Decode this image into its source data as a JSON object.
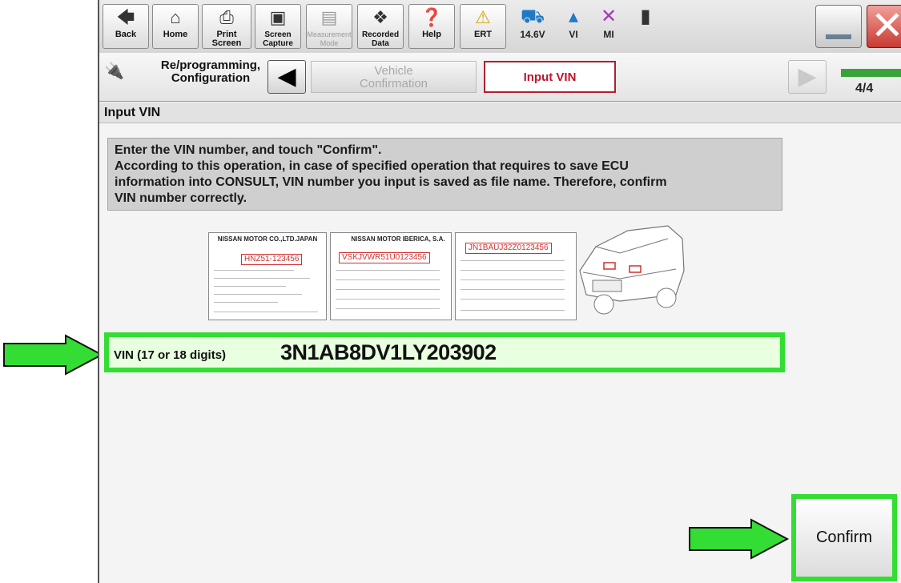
{
  "toolbar": {
    "buttons": [
      {
        "label": "Back",
        "icon": "back-arrow-icon"
      },
      {
        "label": "Home",
        "icon": "home-icon"
      },
      {
        "label": "Print Screen",
        "icon": "printer-icon"
      },
      {
        "label": "Screen Capture",
        "icon": "camera-icon"
      },
      {
        "label": "Measurement Mode",
        "icon": "measure-icon"
      },
      {
        "label": "Recorded Data",
        "icon": "recorded-data-icon"
      },
      {
        "label": "Help",
        "icon": "help-icon"
      },
      {
        "label": "ERT",
        "icon": "warning-icon"
      }
    ],
    "status": {
      "battery_voltage": "14.6V",
      "vi": "VI",
      "mi": "MI"
    }
  },
  "navbar": {
    "crumb_title_line1": "Re/programming,",
    "crumb_title_line2": "Configuration",
    "step_vehicle_line1": "Vehicle",
    "step_vehicle_line2": "Confirmation",
    "step_input": "Input VIN",
    "page_count": "4/4"
  },
  "section": {
    "title": "Input VIN"
  },
  "instruction": {
    "line1": "Enter the VIN number, and touch \"Confirm\".",
    "line2": "According to this operation, in case of specified operation that requires to save ECU",
    "line3": "information into CONSULT, VIN number you input is saved as file name. Therefore, confirm",
    "line4": "VIN number correctly."
  },
  "plates": {
    "japan_header": "NISSAN MOTOR CO.,LTD.JAPAN",
    "japan_vin": "HNZ51-123456",
    "iberica_header": "NISSAN MOTOR IBERICA, S.A.",
    "iberica_vin": "VSKJVWR51U0123456",
    "china_vin": "JN1BAUJ32Z0123456"
  },
  "vin": {
    "label": "VIN (17 or 18 digits)",
    "value": "3N1AB8DV1LY203902"
  },
  "confirm": {
    "label": "Confirm"
  },
  "colors": {
    "highlight_green": "#33dd33",
    "active_step_red": "#c0142c",
    "close_red": "#c73a32"
  }
}
